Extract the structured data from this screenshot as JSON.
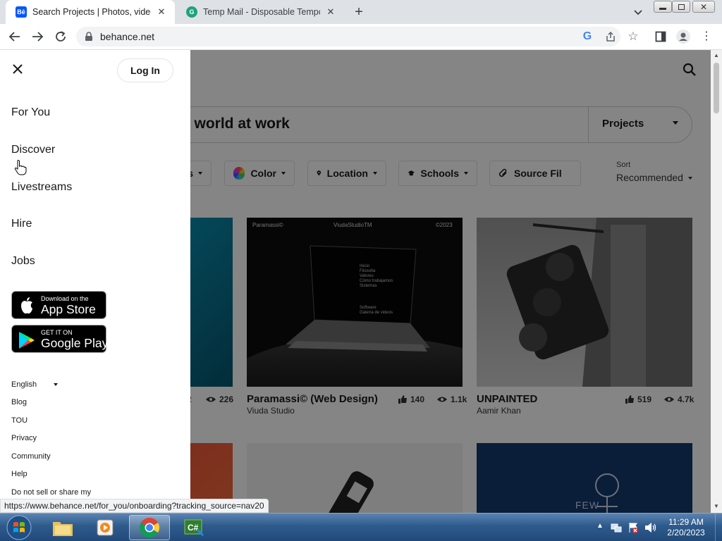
{
  "browser": {
    "tabs": [
      {
        "title": "Search Projects | Photos, videos, l",
        "favicon": "Bē",
        "favicon_color": "#0057ff",
        "active": true
      },
      {
        "title": "Temp Mail - Disposable Tempora",
        "favicon": "G",
        "favicon_color": "#1fa37a",
        "active": false
      }
    ],
    "address": "behance.net",
    "status_url": "https://www.behance.net/for_you/onboarding?tracking_source=nav20"
  },
  "drawer": {
    "login_label": "Log In",
    "nav_items": [
      "For You",
      "Discover",
      "Livestreams",
      "Hire",
      "Jobs"
    ],
    "app_store": {
      "small": "Download on the",
      "big": "App Store"
    },
    "google_play": {
      "small": "GET IT ON",
      "big": "Google Play"
    },
    "footer": {
      "language": "English",
      "links": [
        "Blog",
        "TOU",
        "Privacy",
        "Community",
        "Help",
        "Do not sell or share my"
      ]
    }
  },
  "main": {
    "search_text": "e world at work",
    "search_type": "Projects",
    "filters": [
      "s",
      "Color",
      "Location",
      "Schools",
      "Source Fil"
    ],
    "sort_label": "Sort",
    "sort_value": "Recommended",
    "cards": [
      {
        "title": "",
        "owner": "",
        "likes": "2",
        "views": "226"
      },
      {
        "title": "Paramassi© (Web Design)",
        "owner": "Viuda Studio",
        "likes": "140",
        "views": "1.1k",
        "overlay": {
          "left": "Paramassi©",
          "center": "ViudaStudioTM",
          "right": "©2023"
        },
        "screen_menu": [
          "Inicio",
          "Filosofia",
          "Valores",
          "Cómo trabajamos",
          "Sistemas",
          "Software",
          "Galería de videos"
        ]
      },
      {
        "title": "UNPAINTED",
        "owner": "Aamir Khan",
        "likes": "519",
        "views": "4.7k"
      }
    ],
    "row2_caption": "FEW"
  },
  "taskbar": {
    "time": "11:29 AM",
    "date": "2/20/2023",
    "apps": [
      "file-explorer",
      "media-player",
      "chrome",
      "csharp"
    ]
  },
  "colors": {
    "accent": "#0057ff",
    "overlay": "rgba(0,0,0,0.48)",
    "taskbar": "#2e5a8c"
  }
}
